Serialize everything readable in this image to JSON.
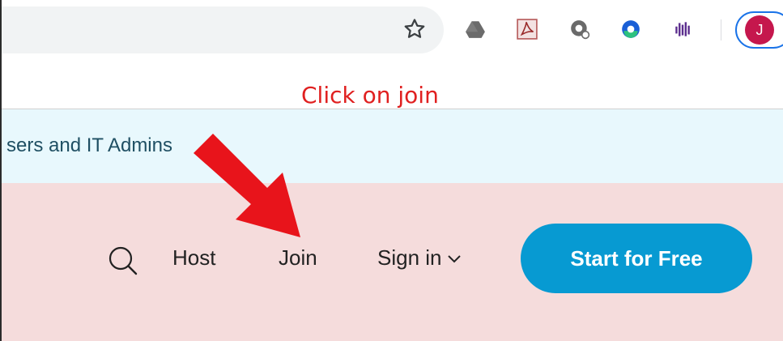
{
  "browser": {
    "avatar_letter": "J",
    "icons": [
      "star-icon",
      "google-drive-icon",
      "pdf-extension-icon",
      "q-extension-icon",
      "circle-extension-icon",
      "bars-extension-icon"
    ]
  },
  "annotation": {
    "text": "Click on join",
    "color": "#e02020"
  },
  "banner": {
    "text": "sers and IT Admins"
  },
  "nav": {
    "host_label": "Host",
    "join_label": "Join",
    "signin_label": "Sign in",
    "start_label": "Start for Free"
  },
  "colors": {
    "accent": "#079ad2",
    "banner_bg": "#e8f8fd",
    "header_bg": "#f5dcdc",
    "arrow": "#e8141b",
    "avatar": "#c5174d"
  }
}
